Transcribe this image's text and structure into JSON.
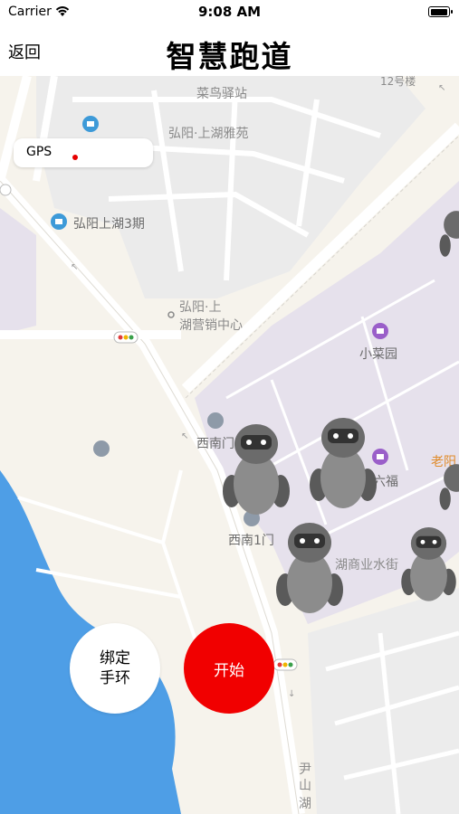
{
  "status_bar": {
    "carrier": "Carrier",
    "time": "9:08 AM",
    "battery_level": 0.9
  },
  "nav": {
    "back": "返回",
    "title": "智慧跑道"
  },
  "gps": {
    "label": "GPS",
    "indicator_color": "#e60000"
  },
  "map": {
    "labels": {
      "cainiao": "菜鸟驿站",
      "yayuan": "弘阳·上湖雅苑",
      "phase3": "弘阳上湖3期",
      "sales_center_1": "弘阳·上",
      "sales_center_2": "湖营销中心",
      "xiaocaiyuan": "小菜园",
      "xinanmen_1": "西南门",
      "liufu": "六福",
      "xinanmen_2": "西南1门",
      "commercial": "湖商业水街",
      "laoyang": "老阳",
      "building12": "12号楼",
      "yinshan_1": "尹",
      "yinshan_2": "山",
      "yinshan_3": "湖"
    }
  },
  "buttons": {
    "bind_line1": "绑定",
    "bind_line2": "手环",
    "start": "开始"
  },
  "colors": {
    "start": "#f10000",
    "water": "#4e9ee6",
    "land": "#f6f3ec",
    "commercial": "#e5e1ea",
    "residential": "#eeeeee"
  }
}
